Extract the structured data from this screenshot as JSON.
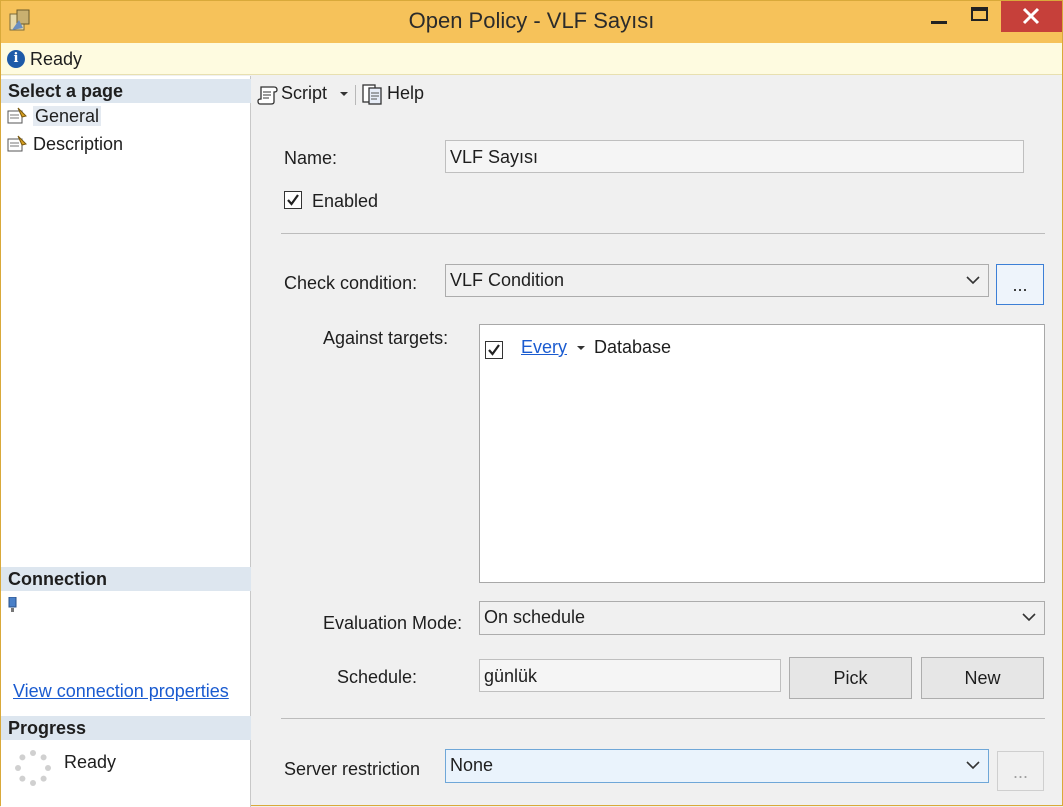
{
  "window": {
    "title": "Open Policy - VLF Sayısı"
  },
  "status": {
    "text": "Ready"
  },
  "left_pane": {
    "select_page_header": "Select a page",
    "pages": [
      {
        "label": "General",
        "selected": true
      },
      {
        "label": "Description",
        "selected": false
      }
    ],
    "connection_header": "Connection",
    "view_connection_link": "View connection properties",
    "progress_header": "Progress",
    "progress_status": "Ready"
  },
  "toolbar": {
    "script_label": "Script",
    "help_label": "Help"
  },
  "form": {
    "name_label": "Name:",
    "name_value": "VLF Sayısı",
    "enabled_label": "Enabled",
    "enabled_checked": true,
    "check_condition_label": "Check condition:",
    "check_condition_value": "VLF Condition",
    "ellipsis_label": "...",
    "against_targets_label": "Against targets:",
    "target": {
      "checked": true,
      "link": "Every",
      "text": "Database"
    },
    "evaluation_mode_label": "Evaluation Mode:",
    "evaluation_mode_value": "On schedule",
    "schedule_label": "Schedule:",
    "schedule_value": "günlük",
    "pick_label": "Pick",
    "new_label": "New",
    "server_restriction_label": "Server restriction",
    "server_restriction_value": "None",
    "server_restriction_ellipsis": "..."
  },
  "colors": {
    "title_bar": "#f6c25a",
    "close_button": "#c6403a",
    "status_bar": "#fefbe0",
    "section_header": "#dde6ef",
    "link": "#1a5bd0"
  },
  "icons": {
    "app": "policy-icon",
    "status": "info-icon",
    "page": "property-page-icon",
    "connection": "server-connection-icon",
    "progress": "spinner-icon",
    "script": "script-icon",
    "help": "help-icon"
  }
}
